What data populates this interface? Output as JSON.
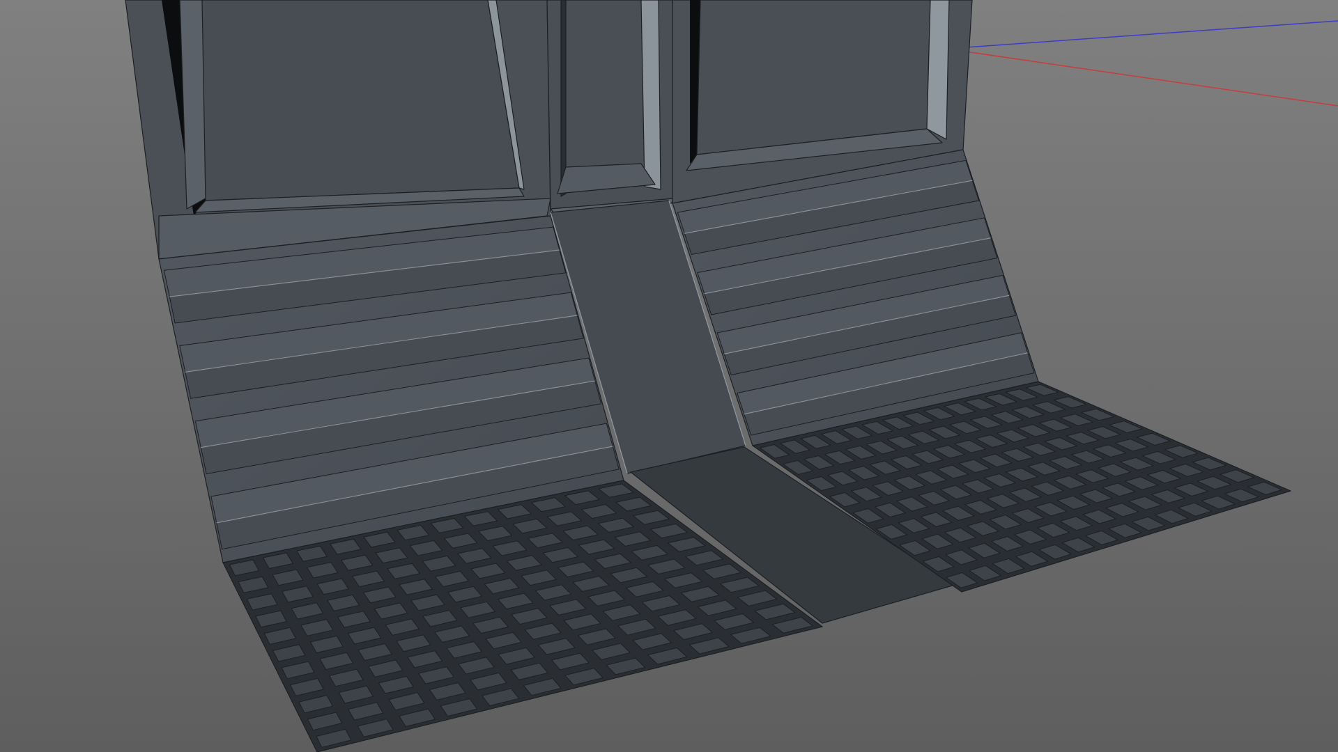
{
  "viewport": {
    "mode": "perspective-3d",
    "background": {
      "top": "#808080",
      "bottom": "#5e5e5e"
    },
    "model": {
      "name": "",
      "panel_color": "#4b5057",
      "panel_dark": "#3f444a",
      "walkway_color": "#353a3e",
      "grate_color": "#2a2e33",
      "grate_cell_color": "#3e434a",
      "wire_color": "#1c1f23"
    },
    "axes": {
      "x_color": "#c83c3c",
      "z_color": "#3c3cc8",
      "y_color": "#3cc83c"
    }
  }
}
